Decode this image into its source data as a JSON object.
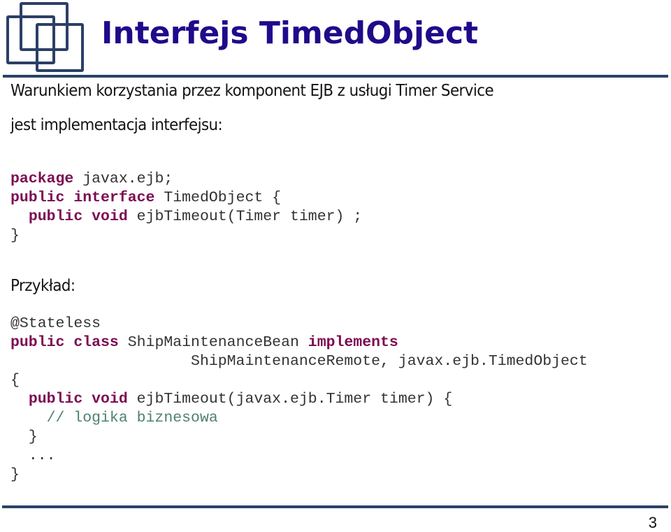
{
  "slide": {
    "title": "Interfejs TimedObject",
    "intro_line1": "Warunkiem korzystania przez komponent EJB z usługi Timer Service",
    "intro_line2": "jest implementacja interfejsu:",
    "example_label": "Przykład:",
    "page_number": "3",
    "logo_icon": "overlapping-squares-logo",
    "colors": {
      "title": "#200a8a",
      "keyword": "#7d0a52",
      "comment": "#4f7f70",
      "rule": "#2c4266"
    }
  },
  "code_interface": [
    {
      "indent": "",
      "tokens": [
        {
          "t": "package",
          "k": "kw"
        },
        {
          "t": " javax.ejb;",
          "k": "plain"
        }
      ]
    },
    {
      "indent": "",
      "tokens": [
        {
          "t": "public",
          "k": "kw"
        },
        {
          "t": " ",
          "k": "plain"
        },
        {
          "t": "interface",
          "k": "kw"
        },
        {
          "t": " TimedObject {",
          "k": "plain"
        }
      ]
    },
    {
      "indent": "  ",
      "tokens": [
        {
          "t": "public",
          "k": "kw"
        },
        {
          "t": " ",
          "k": "plain"
        },
        {
          "t": "void",
          "k": "kw"
        },
        {
          "t": " ejbTimeout(Timer timer) ;",
          "k": "plain"
        }
      ]
    },
    {
      "indent": "",
      "tokens": [
        {
          "t": "}",
          "k": "plain"
        }
      ]
    }
  ],
  "code_example": [
    {
      "indent": "",
      "tokens": [
        {
          "t": "@Stateless",
          "k": "plain"
        }
      ]
    },
    {
      "indent": "",
      "tokens": [
        {
          "t": "public",
          "k": "kw"
        },
        {
          "t": " ",
          "k": "plain"
        },
        {
          "t": "class",
          "k": "kw"
        },
        {
          "t": " ShipMaintenanceBean ",
          "k": "plain"
        },
        {
          "t": "implements",
          "k": "kw"
        }
      ]
    },
    {
      "indent": "                    ",
      "tokens": [
        {
          "t": "ShipMaintenanceRemote, javax.ejb.TimedObject",
          "k": "plain"
        }
      ]
    },
    {
      "indent": "",
      "tokens": [
        {
          "t": "{",
          "k": "plain"
        }
      ]
    },
    {
      "indent": "  ",
      "tokens": [
        {
          "t": "public",
          "k": "kw"
        },
        {
          "t": " ",
          "k": "plain"
        },
        {
          "t": "void",
          "k": "kw"
        },
        {
          "t": " ejbTimeout(javax.ejb.Timer timer) {",
          "k": "plain"
        }
      ]
    },
    {
      "indent": "    ",
      "tokens": [
        {
          "t": "// logika biznesowa",
          "k": "cm"
        }
      ]
    },
    {
      "indent": "  ",
      "tokens": [
        {
          "t": "}",
          "k": "plain"
        }
      ]
    },
    {
      "indent": "  ",
      "tokens": [
        {
          "t": "...",
          "k": "plain"
        }
      ]
    },
    {
      "indent": "",
      "tokens": [
        {
          "t": "}",
          "k": "plain"
        }
      ]
    }
  ]
}
